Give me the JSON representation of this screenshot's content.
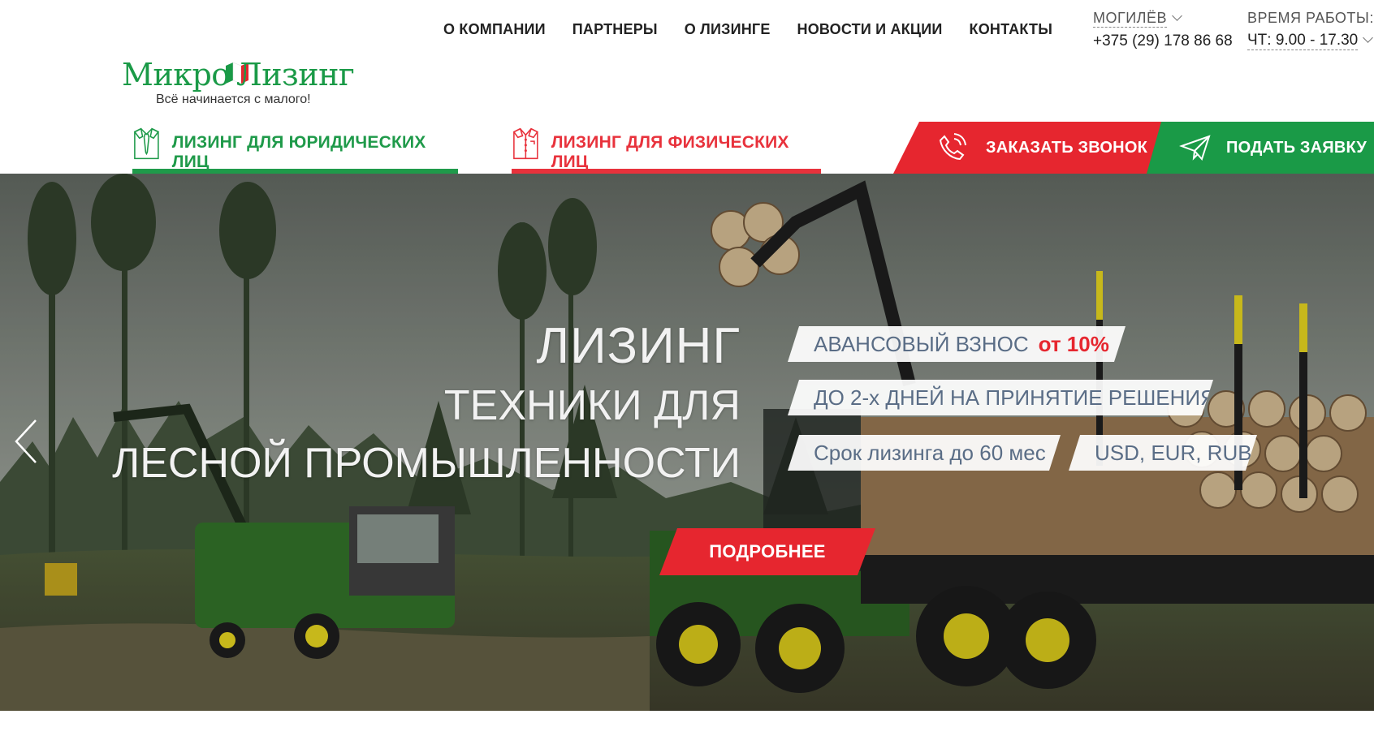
{
  "brand": {
    "name_left": "Микро",
    "name_right": "Лизинг",
    "tagline": "Всё начинается с малого!",
    "colors": {
      "green": "#1a9a47",
      "red": "#e6262f"
    }
  },
  "nav": {
    "items": [
      {
        "label": "О КОМПАНИИ"
      },
      {
        "label": "ПАРТНЕРЫ"
      },
      {
        "label": "О ЛИЗИНГЕ"
      },
      {
        "label": "НОВОСТИ И АКЦИИ"
      },
      {
        "label": "КОНТАКТЫ"
      }
    ]
  },
  "contact": {
    "city": "МОГИЛЁВ",
    "phone": "+375 (29) 178 86 68"
  },
  "work_hours": {
    "label": "ВРЕМЯ РАБОТЫ:",
    "value": "ЧТ: 9.00 - 17.30"
  },
  "tabs": {
    "legal": {
      "label": "ЛИЗИНГ ДЛЯ ЮРИДИЧЕСКИХ ЛИЦ",
      "icon": "tie-shirt-icon"
    },
    "personal": {
      "label": "ЛИЗИНГ ДЛЯ ФИЗИЧЕСКИХ ЛИЦ",
      "icon": "shirt-icon"
    }
  },
  "cta": {
    "call": {
      "label": "ЗАКАЗАТЬ ЗВОНОК",
      "icon": "phone-icon"
    },
    "request": {
      "label": "ПОДАТЬ ЗАЯВКУ",
      "icon": "paper-plane-icon"
    }
  },
  "hero": {
    "title_line1": "ЛИЗИНГ",
    "title_line2": "ТЕХНИКИ ДЛЯ",
    "title_line3": "ЛЕСНОЙ ПРОМЫШЛЕННОСТИ",
    "features": {
      "advance_label": "АВАНСОВЫЙ ВЗНОС",
      "advance_value": "от 10%",
      "decision": "ДО 2-х ДНЕЙ НА ПРИНЯТИЕ РЕШЕНИЯ",
      "term": "Срок лизинга до 60 мес",
      "currencies": "USD, EUR, RUB"
    },
    "more_button": "ПОДРОБНЕЕ",
    "prev_icon": "chevron-left-icon"
  }
}
